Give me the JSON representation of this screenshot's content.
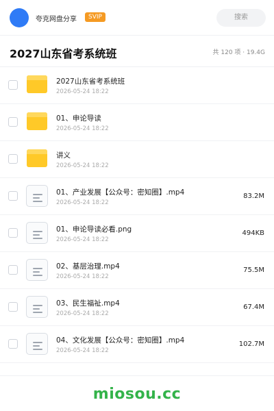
{
  "header": {
    "username": "夸克网盘分享",
    "badge": "SVIP",
    "search_placeholder": "搜索",
    "accent_color": "#2f7bf6",
    "badge_color": "#f59a23"
  },
  "folder": {
    "title": "2027山东省考系统班",
    "summary": "共 120 项 · 19.4G"
  },
  "files": [
    {
      "type": "folder",
      "icon": "folder-icon",
      "name": "2027山东省考系统班",
      "date": "2026-05-24 18:22",
      "size": ""
    },
    {
      "type": "folder",
      "icon": "folder-icon",
      "name": "01、申论导读",
      "date": "2026-05-24 18:22",
      "size": ""
    },
    {
      "type": "folder",
      "icon": "folder-icon",
      "name": "讲义",
      "date": "2026-05-24 18:22",
      "size": ""
    },
    {
      "type": "file",
      "icon": "document-icon",
      "name": "01、产业发展【公众号：密知圈】.mp4",
      "date": "2026-05-24 18:22",
      "size": "83.2M"
    },
    {
      "type": "file",
      "icon": "document-icon",
      "name": "01、申论导读必看.png",
      "date": "2026-05-24 18:22",
      "size": "494KB"
    },
    {
      "type": "file",
      "icon": "document-icon",
      "name": "02、基层治理.mp4",
      "date": "2026-05-24 18:22",
      "size": "75.5M"
    },
    {
      "type": "file",
      "icon": "document-icon",
      "name": "03、民生福祉.mp4",
      "date": "2026-05-24 18:22",
      "size": "67.4M"
    },
    {
      "type": "file",
      "icon": "document-icon",
      "name": "04、文化发展【公众号：密知圈】.mp4",
      "date": "2026-05-24 18:22",
      "size": "102.7M"
    }
  ],
  "footer": {
    "watermark": "miosou.cc",
    "watermark_color": "#33b34a"
  }
}
